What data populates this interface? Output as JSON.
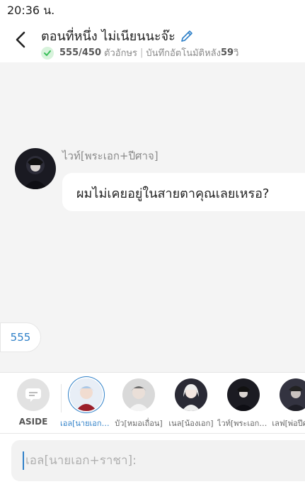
{
  "status_bar": {
    "time": "20:36 น."
  },
  "header": {
    "title": "ตอนที่หนึ่ง ไม่เนียนนะจ๊ะ",
    "char_count": "555/450",
    "char_label": "ตัวอักษร",
    "autosave": "บันทึกอัตโนมัติหลัง",
    "autosave_seconds": "59",
    "autosave_unit": "วิ"
  },
  "chat": {
    "speaker": "ไวท์[พระเอก+ปีศาจ]",
    "message": "ผมไม่เคยอยู่ในสายตาคุณเลยเหรอ?",
    "aside_text": "555"
  },
  "characters": [
    {
      "label": "ASIDE",
      "icon": "message-icon"
    },
    {
      "label": "เอล[นายเอก+ราชา]",
      "selected": true,
      "color": "#3b4c8c"
    },
    {
      "label": "บัว[หมอเถื่อน]",
      "color": "#8d8d8d"
    },
    {
      "label": "เนล[น้องเอก]",
      "color": "#2a2a35"
    },
    {
      "label": "ไวท์[พระเอก+ปีศาจ]",
      "color": "#1b1b22"
    },
    {
      "label": "เลฟ[พ่อปีศาจ]",
      "color": "#333340"
    }
  ],
  "input": {
    "placeholder": "เอล[นายเอก+ราชา]:"
  },
  "colors": {
    "accent": "#2f80c8",
    "check": "#3bbf5a"
  }
}
